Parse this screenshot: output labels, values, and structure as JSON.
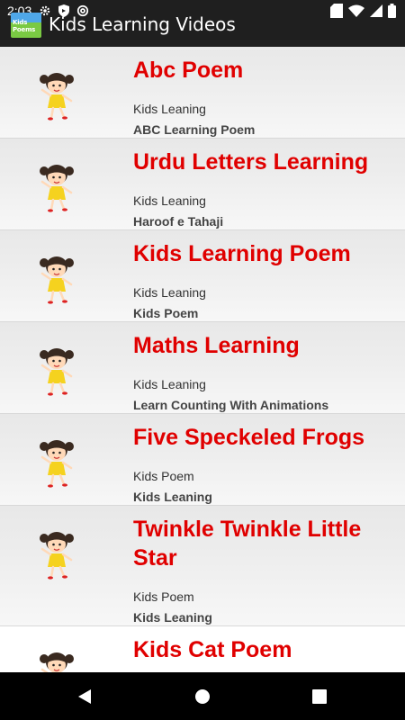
{
  "status_bar": {
    "time": "2:03"
  },
  "app_bar": {
    "logo_text": "Kids Poems",
    "title": "Kids Learning Videos"
  },
  "videos": [
    {
      "title": "Abc Poem",
      "category": "Kids Leaning",
      "subtitle": "ABC Learning Poem"
    },
    {
      "title": "Urdu Letters Learning",
      "category": "Kids Leaning",
      "subtitle": "Haroof e Tahaji"
    },
    {
      "title": "Kids Learning Poem",
      "category": "Kids Leaning",
      "subtitle": "Kids Poem"
    },
    {
      "title": "Maths Learning",
      "category": "Kids Leaning",
      "subtitle": "Learn Counting With Animations"
    },
    {
      "title": "Five Speckeled Frogs",
      "category": "Kids Poem",
      "subtitle": "Kids Leaning"
    },
    {
      "title": "Twinkle Twinkle Little Star",
      "category": "Kids Poem",
      "subtitle": "Kids Leaning"
    },
    {
      "title": "Kids Cat Poem",
      "category": "",
      "subtitle": ""
    }
  ],
  "colors": {
    "title_red": "#e00000",
    "appbar": "#1f1f1f",
    "navbar": "#000000"
  },
  "icons": [
    "settings-icon",
    "shield-icon",
    "at-sign-icon",
    "sd-card-icon",
    "wifi-icon",
    "signal-icon",
    "battery-icon",
    "back-icon",
    "home-icon",
    "recents-icon",
    "girl-cartoon-icon"
  ]
}
